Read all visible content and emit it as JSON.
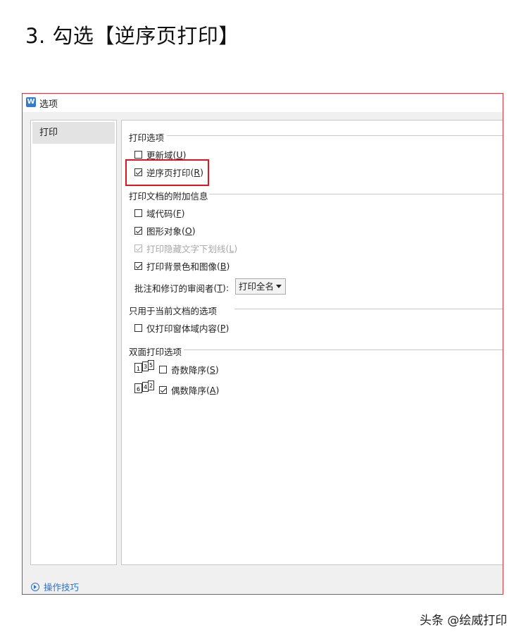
{
  "heading": "3. 勾选【逆序页打印】",
  "dialog": {
    "title": "选项",
    "app_icon": "W",
    "sidebar": {
      "items": [
        {
          "label": "打印"
        }
      ]
    },
    "groups": {
      "print_options": "打印选项",
      "print_extras": "打印文档的附加信息",
      "current_doc": "只用于当前文档的选项",
      "duplex": "双面打印选项"
    },
    "options": {
      "update_fields": {
        "label": "更新域",
        "key": "U",
        "checked": false
      },
      "reverse_order": {
        "label": "逆序页打印",
        "key": "R",
        "checked": true
      },
      "field_codes": {
        "label": "域代码",
        "key": "F",
        "checked": false
      },
      "drawing_objects": {
        "label": "图形对象",
        "key": "O",
        "checked": true
      },
      "hidden_text": {
        "label": "打印隐藏文字下划线",
        "key": "L",
        "checked": true,
        "disabled": true
      },
      "background": {
        "label": "打印背景色和图像",
        "key": "B",
        "checked": true
      },
      "form_data": {
        "label": "仅打印窗体域内容",
        "key": "P",
        "checked": false
      },
      "odd_desc": {
        "label": "奇数降序",
        "key": "S",
        "checked": false
      },
      "even_desc": {
        "label": "偶数降序",
        "key": "A",
        "checked": true
      }
    },
    "comments": {
      "label": "批注和修订的审阅者",
      "key": "T",
      "suffix": ":",
      "value": "打印全名"
    },
    "footer": {
      "tips": "操作技巧"
    }
  },
  "watermark": "头条 @绘威打印",
  "colors": {
    "highlight": "#e0161e",
    "dialog_border": "#d9363e",
    "link": "#2f6fd0",
    "icon": "#2f7bd6"
  },
  "icons": {
    "app": "wps-writer-icon",
    "tips": "play-circle-icon",
    "odd_pages": "odd-pages-icon",
    "even_pages": "even-pages-icon",
    "dropdown": "chevron-down-icon"
  }
}
